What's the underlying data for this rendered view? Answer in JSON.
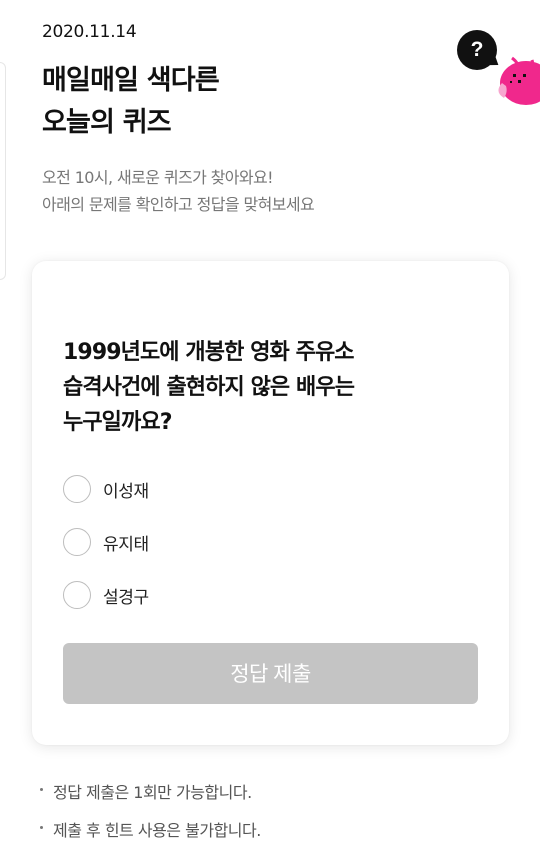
{
  "header": {
    "date": "2020.11.14",
    "title_lines": [
      "매일매일 색다른",
      "오늘의 퀴즈"
    ],
    "subtitle_lines": [
      "오전 10시, 새로운 퀴즈가 찾아와요!",
      "아래의 문제를 확인하고 정답을 맞혀보세요"
    ],
    "help_icon": "question-mark-icon",
    "help_label": "?"
  },
  "quiz": {
    "question_lines": [
      "1999년도에 개봉한 영화 주유소",
      "습격사건에 출현하지 않은 배우는",
      "누구일까요?"
    ],
    "options": [
      {
        "label": "이성재",
        "selected": false
      },
      {
        "label": "유지태",
        "selected": false
      },
      {
        "label": "설경구",
        "selected": false
      }
    ],
    "submit_label": "정답 제출",
    "submit_enabled": false
  },
  "notes": [
    "정답 제출은 1회만 가능합니다.",
    "제출 후 힌트 사용은 불가합니다."
  ],
  "colors": {
    "accent_mascot": "#f0288c",
    "submit_disabled": "#c4c4c4",
    "text_primary": "#111111",
    "text_secondary": "#777777"
  }
}
